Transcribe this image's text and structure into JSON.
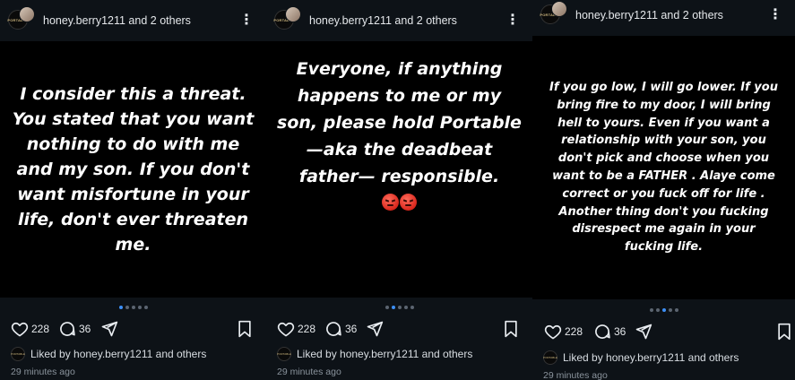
{
  "posts": [
    {
      "header": {
        "username": "honey.berry1211 and 2 others",
        "avatar_text": "PORTABLE"
      },
      "story_text": "I consider this a threat. You stated that you want nothing to do with me and my son. If you don't want misfortune in your life, don't ever threaten me.",
      "has_emojis": false,
      "likes": "228",
      "comments": "36",
      "liked_by": "Liked by honey.berry1211 and others",
      "time": "29 minutes ago",
      "carousel": {
        "count": 5,
        "active_index": 0
      }
    },
    {
      "header": {
        "username": "honey.berry1211 and 2 others",
        "avatar_text": "PORTABLE"
      },
      "story_text": "Everyone, if anything happens to me or my son, please hold Portable—aka the deadbeat father— responsible.",
      "has_emojis": true,
      "emojis": [
        "angry-face",
        "angry-face"
      ],
      "likes": "228",
      "comments": "36",
      "liked_by": "Liked by honey.berry1211 and others",
      "time": "29 minutes ago",
      "carousel": {
        "count": 5,
        "active_index": 1
      }
    },
    {
      "header": {
        "username": "honey.berry1211 and 2 others",
        "avatar_text": "PORTABLE"
      },
      "story_text": "If you go low, I will go lower. If you bring fire to my door, I will bring hell to yours. Even if you want a relationship with your son, you don't  pick and choose when you want to be a FATHER . Alaye come correct or you fuck off for life . Another thing don't you fucking disrespect me again in your fucking life.",
      "has_emojis": false,
      "likes": "228",
      "comments": "36",
      "liked_by": "Liked by honey.berry1211 and others",
      "time": "29 minutes ago",
      "carousel": {
        "count": 5,
        "active_index": 2
      }
    }
  ],
  "colors": {
    "background": "#0d1217",
    "story_background": "#000000",
    "dot_active": "#3d8ff6",
    "dot_inactive": "#5b6470"
  },
  "icons": {
    "more": "more-vertical-icon",
    "like": "heart-icon",
    "comment": "comment-icon",
    "share": "send-icon",
    "save": "bookmark-icon"
  }
}
